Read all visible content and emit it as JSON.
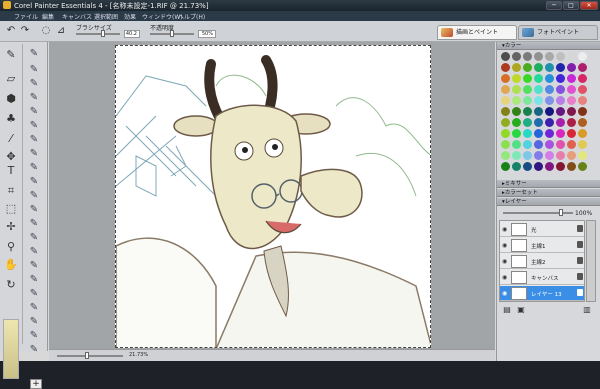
{
  "window": {
    "title": "Corel Painter Essentials 4 - [名称未設定-1.RIF @ 21.73%]",
    "minimize": "─",
    "maximize": "□",
    "close": "✕"
  },
  "menu": [
    "ファイル",
    "編集",
    "キャンバス",
    "選択範囲",
    "効果",
    "ウィンドウ(W)",
    "ヘルプ(H)"
  ],
  "property_bar": {
    "brush_size_label": "ブラシサイズ",
    "brush_size_value": "40.2",
    "opacity_label": "不透明度",
    "opacity_value": "50%"
  },
  "tabs": {
    "paint": "描画とペイント",
    "photo": "フォトペイント"
  },
  "panels": {
    "color": "カラー",
    "mixer": "ミキサー",
    "color_set": "カラーセット",
    "layers": "レイヤー"
  },
  "layer_options": {
    "opacity_value": "100%"
  },
  "layers": [
    {
      "name": "光",
      "selected": false
    },
    {
      "name": "主線1",
      "selected": false
    },
    {
      "name": "主線2",
      "selected": false
    },
    {
      "name": "キャンバス",
      "selected": false
    },
    {
      "name": "レイヤー 13",
      "selected": true
    }
  ],
  "status": {
    "zoom": "21.73%"
  },
  "colors": {
    "accent": "#3b8ee6",
    "titlebar": "#2c3a44"
  }
}
